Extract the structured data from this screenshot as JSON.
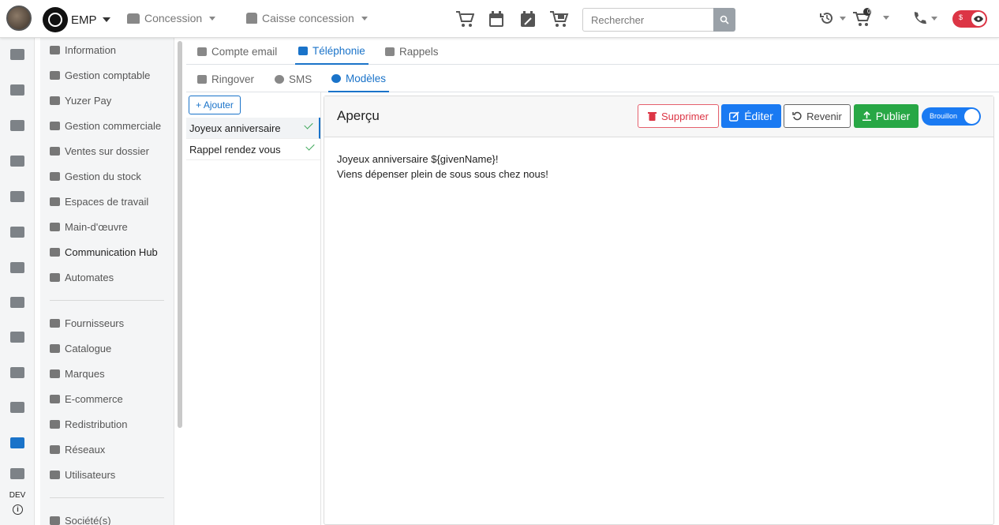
{
  "header": {
    "brand": "EMP",
    "nav_dropdowns": [
      "Concession",
      "Caisse concession"
    ],
    "search_placeholder": "Rechercher",
    "cart_count": "0",
    "mode_symbol": "$"
  },
  "rail": {
    "icons": [
      "home-icon",
      "handshake-icon",
      "ski-icon",
      "motorbike-icon",
      "bicycle-icon",
      "boxes-icon",
      "warehouse-icon",
      "calendar-icon",
      "wrench-icon",
      "dollar-icon",
      "chart-icon",
      "gears-icon",
      "user-tie-icon"
    ],
    "env_label": "DEV",
    "info_symbol": "i"
  },
  "sidebar": {
    "items": [
      {
        "label": "Information",
        "icon": "chart-icon"
      },
      {
        "label": "Gestion comptable",
        "icon": "dollar-icon"
      },
      {
        "label": "Yuzer Pay",
        "icon": "card-icon"
      },
      {
        "label": "Gestion commerciale",
        "icon": "handshake-icon"
      },
      {
        "label": "Ventes sur dossier",
        "icon": "star-icon"
      },
      {
        "label": "Gestion du stock",
        "icon": "warehouse-icon"
      },
      {
        "label": "Espaces de travail",
        "icon": "layers-icon"
      },
      {
        "label": "Main-d'œuvre",
        "icon": "people-gear-icon"
      },
      {
        "label": "Communication Hub",
        "icon": "antenna-icon"
      },
      {
        "label": "Automates",
        "icon": "robot-icon"
      },
      {
        "label": "Fournisseurs",
        "icon": "supplier-icon"
      },
      {
        "label": "Catalogue",
        "icon": "books-icon"
      },
      {
        "label": "Marques",
        "icon": "copyright-icon"
      },
      {
        "label": "E-commerce",
        "icon": "window-icon"
      },
      {
        "label": "Redistribution",
        "icon": "network-icon"
      },
      {
        "label": "Réseaux",
        "icon": "nodes-icon"
      },
      {
        "label": "Utilisateurs",
        "icon": "users-icon"
      },
      {
        "label": "Société(s)",
        "icon": "building-icon"
      }
    ]
  },
  "tabs_primary": [
    {
      "label": "Compte email",
      "icon": "envelope-icon"
    },
    {
      "label": "Téléphonie",
      "icon": "phone-icon"
    },
    {
      "label": "Rappels",
      "icon": "calendar-icon"
    }
  ],
  "tabs_secondary": [
    {
      "label": "Ringover",
      "icon": "phone-icon"
    },
    {
      "label": "SMS",
      "icon": "chat-icon"
    },
    {
      "label": "Modèles",
      "icon": "chat-icon"
    }
  ],
  "templates": {
    "add_label": "+ Ajouter",
    "items": [
      "Joyeux anniversaire",
      "Rappel rendez vous"
    ]
  },
  "preview": {
    "title": "Aperçu",
    "buttons": {
      "delete": "Supprimer",
      "edit": "Éditer",
      "revert": "Revenir",
      "publish": "Publier"
    },
    "status_toggle": "Brouillon",
    "body_lines": [
      "Joyeux anniversaire ${givenName}!",
      "Viens dépenser plein de sous sous chez nous!"
    ]
  },
  "colors": {
    "accent": "#1a73c9",
    "danger": "#dc3545",
    "success": "#28a745"
  }
}
